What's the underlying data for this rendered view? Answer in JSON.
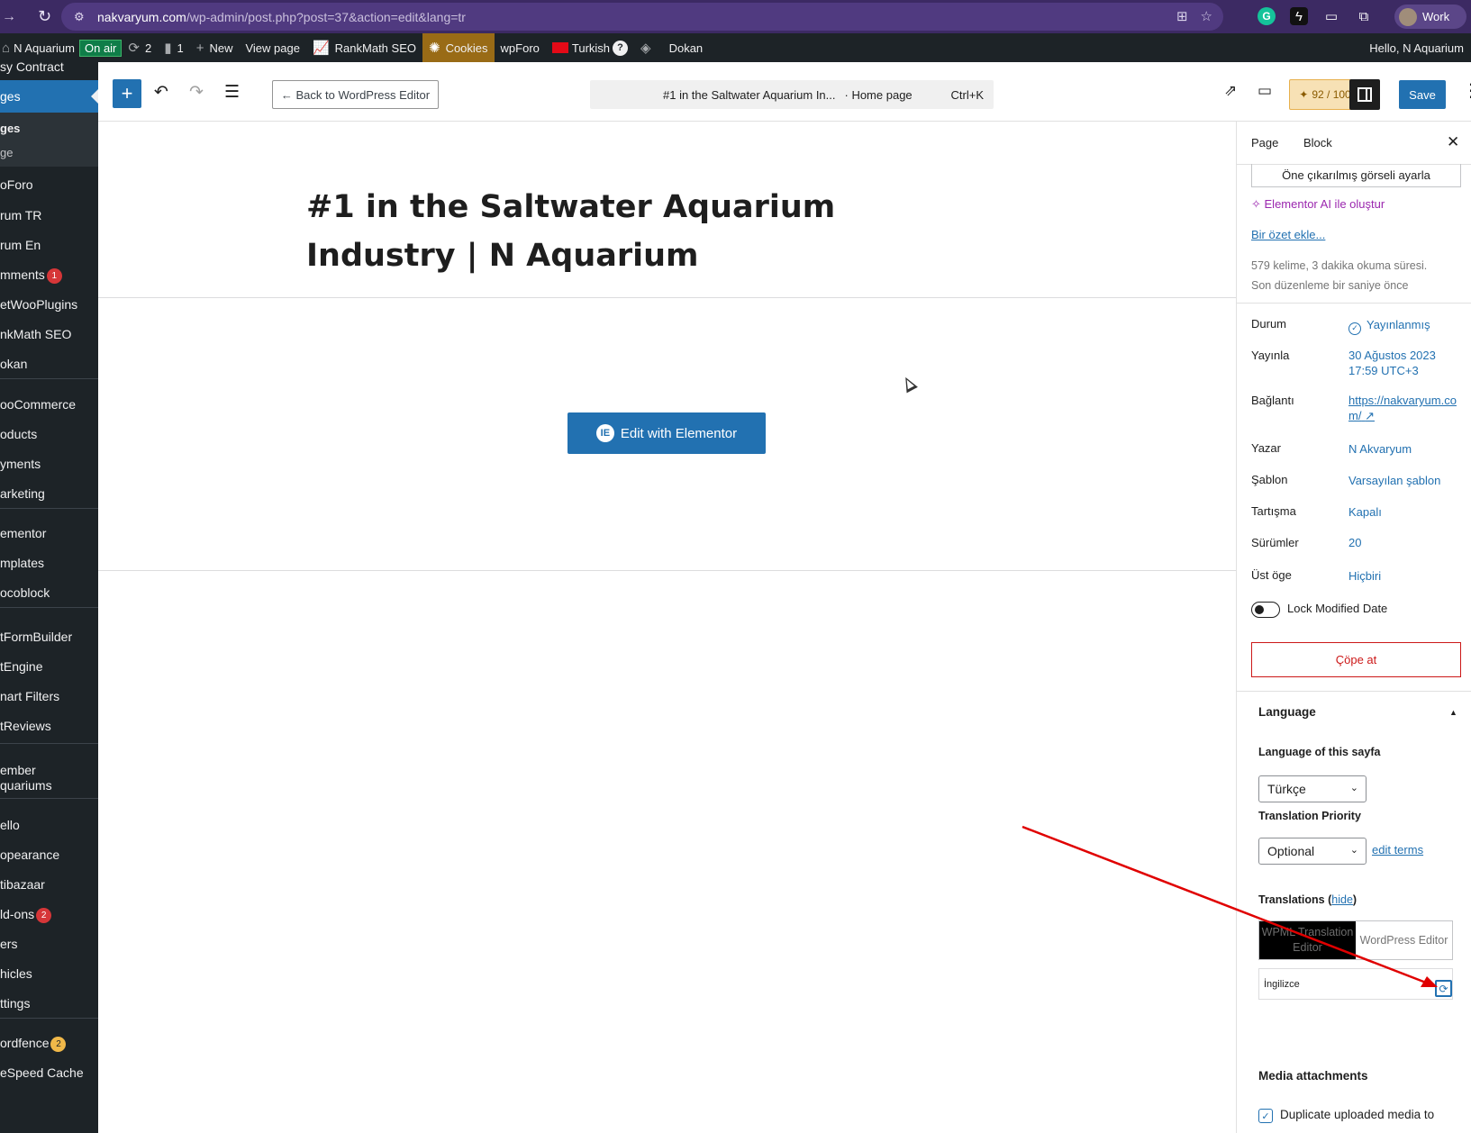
{
  "browser": {
    "url_host": "nakvaryum.com",
    "url_path": "/wp-admin/post.php?post=37&action=edit&lang=tr",
    "profile_label": "Work",
    "icons": [
      "forward-icon",
      "reload-icon",
      "site-info-icon",
      "translate-icon",
      "bookmark-star-icon",
      "grammarly-icon",
      "extension-icon",
      "puzzle-icon"
    ]
  },
  "admin_bar": {
    "site_name": "N Aquarium",
    "on_air": "On air",
    "updates_count": "2",
    "comments_count": "1",
    "new_label": "New",
    "view_page": "View page",
    "rankmath": "RankMath SEO",
    "cookies": "Cookies",
    "wpforo": "wpForo",
    "language": "Turkish",
    "dokan": "Dokan",
    "greeting": "Hello, N Aquarium"
  },
  "sidebar": {
    "items": [
      {
        "label": "sy Contract"
      },
      {
        "label": "ges"
      },
      {
        "label": "ges"
      },
      {
        "label": "ge"
      },
      {
        "label": "oForo"
      },
      {
        "label": "rum TR"
      },
      {
        "label": "rum En"
      },
      {
        "label": "mments",
        "badge": "1"
      },
      {
        "label": "etWooPlugins"
      },
      {
        "label": "nkMath SEO"
      },
      {
        "label": "okan"
      },
      {
        "label": "ooCommerce"
      },
      {
        "label": "oducts"
      },
      {
        "label": "yments"
      },
      {
        "label": "arketing"
      },
      {
        "label": "ementor"
      },
      {
        "label": "mplates"
      },
      {
        "label": "ocoblock"
      },
      {
        "label": "tFormBuilder"
      },
      {
        "label": "tEngine"
      },
      {
        "label": "nart Filters"
      },
      {
        "label": "tReviews"
      },
      {
        "label": "ember"
      },
      {
        "label": "quariums"
      },
      {
        "label": "ello"
      },
      {
        "label": "opearance"
      },
      {
        "label": "tibazaar"
      },
      {
        "label": "ld-ons",
        "badge": "2"
      },
      {
        "label": "ers"
      },
      {
        "label": "hicles"
      },
      {
        "label": "ttings"
      },
      {
        "label": "ordfence",
        "badge": "2"
      },
      {
        "label": "eSpeed Cache"
      }
    ]
  },
  "editor_header": {
    "back_label": "← Back to WordPress Editor",
    "doc_title": "#1 in the Saltwater Aquarium In...",
    "doc_type": "· Home page",
    "shortcut": "Ctrl+K",
    "seo_score": "92 / 100",
    "save_label": "Save"
  },
  "canvas": {
    "title": "#1 in the Saltwater Aquarium Industry | N Aquarium",
    "elementor_button": "Edit with Elementor",
    "elementor_icon_text": "IE"
  },
  "panel": {
    "tab_page": "Page",
    "tab_block": "Block",
    "featured_image": "Öne çıkarılmış görseli ayarla",
    "ai_link": "Elementor AI ile oluştur",
    "excerpt_link": "Bir özet ekle...",
    "word_count": "579 kelime, 3 dakika okuma süresi.",
    "last_edit": "Son düzenleme bir saniye önce",
    "rows": {
      "status_label": "Durum",
      "status_value": "Yayınlanmış",
      "publish_label": "Yayınla",
      "publish_date": "30 Ağustos 2023",
      "publish_time": "17:59 UTC+3",
      "link_label": "Bağlantı",
      "link_value_1": "https://nakvaryum.co",
      "link_value_2": "m/",
      "author_label": "Yazar",
      "author_value": "N Akvaryum",
      "template_label": "Şablon",
      "template_value": "Varsayılan şablon",
      "discussion_label": "Tartışma",
      "discussion_value": "Kapalı",
      "revisions_label": "Sürümler",
      "revisions_value": "20",
      "parent_label": "Üst öge",
      "parent_value": "Hiçbiri"
    },
    "lock_modified": "Lock Modified Date",
    "trash": "Çöpe at",
    "language": {
      "heading": "Language",
      "lang_of_page": "Language of this sayfa",
      "lang_value": "Türkçe",
      "priority_heading": "Translation Priority",
      "priority_value": "Optional",
      "edit_terms": "edit terms",
      "translations_heading": "Translations",
      "hide_link": "hide",
      "wpml_editor": "WPML Translation Editor",
      "wp_editor": "WordPress Editor",
      "translation_lang": "İngilizce"
    },
    "media_heading": "Media attachments",
    "duplicate_media": "Duplicate uploaded media to"
  },
  "colors": {
    "wp_blue": "#2271b1",
    "admin_dark": "#1d2327",
    "browser_purple": "#3c2a63",
    "annotation_red": "#e00000",
    "danger": "#cc1818"
  }
}
